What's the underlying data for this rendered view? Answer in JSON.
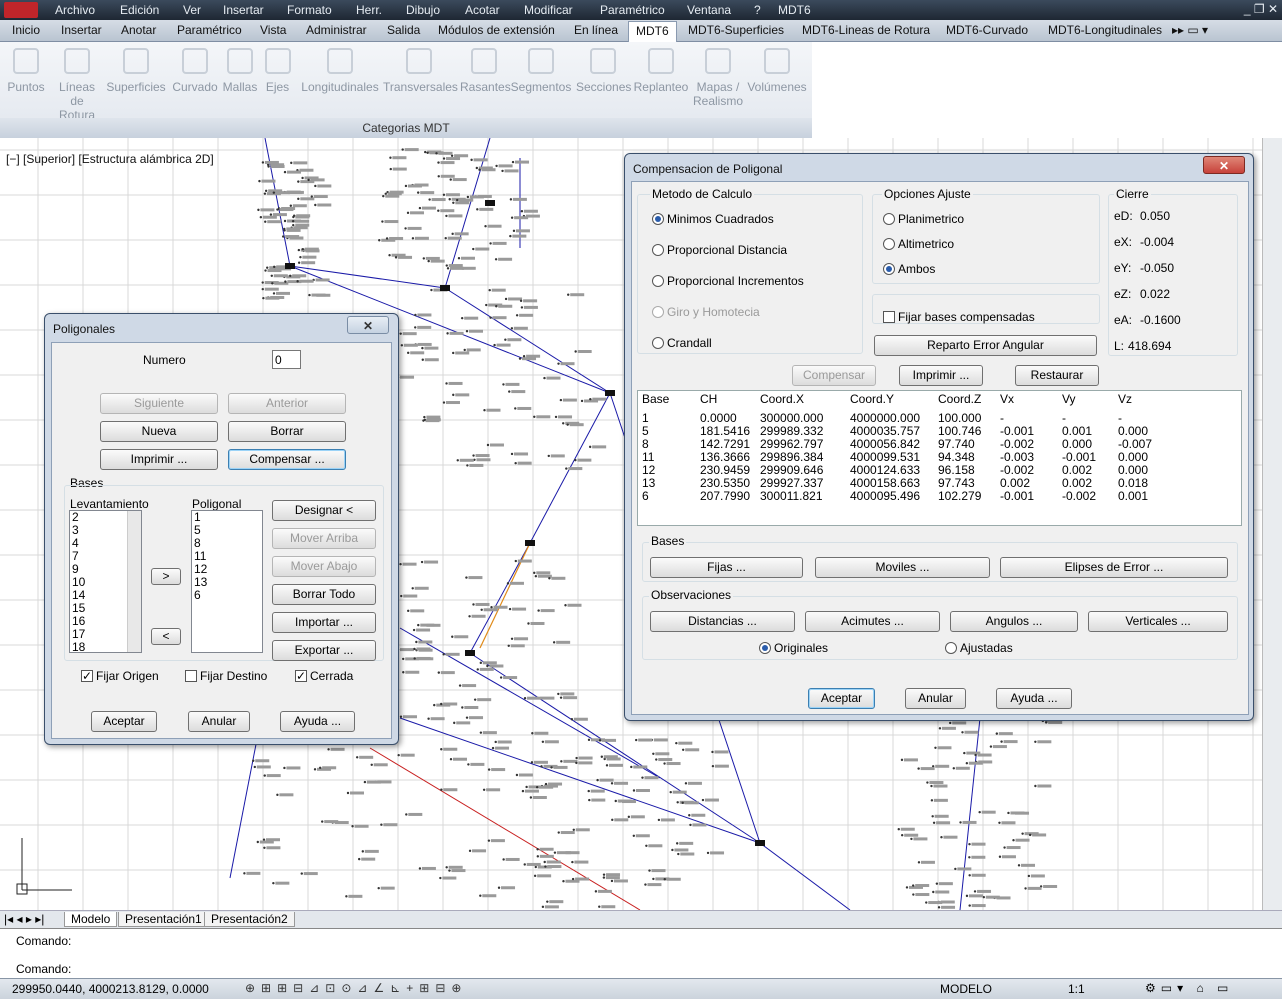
{
  "menubar": {
    "items": [
      "Archivo",
      "Edición",
      "Ver",
      "Insertar",
      "Formato",
      "Herr.",
      "Dibujo",
      "Acotar",
      "Modificar",
      "Paramétrico",
      "Ventana",
      "?",
      "MDT6"
    ]
  },
  "tabs": {
    "items": [
      "Inicio",
      "Insertar",
      "Anotar",
      "Paramétrico",
      "Vista",
      "Administrar",
      "Salida",
      "Módulos de extensión",
      "En línea",
      "MDT6",
      "MDT6-Superficies",
      "MDT6-Lineas de Rotura",
      "MDT6-Curvado",
      "MDT6-Longitudinales"
    ],
    "active": "MDT6"
  },
  "ribbon": {
    "buttons": [
      "Puntos",
      "Líneas de Rotura",
      "Superficies",
      "Curvado",
      "Mallas",
      "Ejes",
      "Longitudinales",
      "Transversales",
      "Rasantes",
      "Segmentos",
      "Secciones",
      "Replanteo",
      "Mapas / Realismo",
      "Volúmenes"
    ],
    "panel_title": "Categorias MDT"
  },
  "viewport": {
    "label": "[−] [Superior] [Estructura alámbrica 2D]"
  },
  "layout_tabs": [
    "Modelo",
    "Presentación1",
    "Presentación2"
  ],
  "command": {
    "line1": "Comando:",
    "line2": "Comando:"
  },
  "status": {
    "coords": "299950.0440, 4000213.8129, 0.0000",
    "mode": "MODELO",
    "scale": "1:1"
  },
  "poligonales": {
    "title": "Poligonales",
    "numero_label": "Numero",
    "numero_value": "0",
    "siguiente": "Siguiente",
    "anterior": "Anterior",
    "nueva": "Nueva",
    "borrar": "Borrar",
    "imprimir": "Imprimir ...",
    "compensar": "Compensar ...",
    "bases_label": "Bases",
    "levantamiento_label": "Levantamiento",
    "poligonal_label": "Poligonal",
    "levantamiento": [
      "2",
      "3",
      "4",
      "7",
      "9",
      "10",
      "14",
      "15",
      "16",
      "17",
      "18"
    ],
    "poligonal": [
      "1",
      "5",
      "8",
      "11",
      "12",
      "13",
      "6"
    ],
    "designar": "Designar <",
    "mover_arriba": "Mover Arriba",
    "mover_abajo": "Mover Abajo",
    "borrar_todo": "Borrar Todo",
    "importar": "Importar ...",
    "exportar": "Exportar ...",
    "fijar_origen": "Fijar Origen",
    "fijar_destino": "Fijar Destino",
    "cerrada": "Cerrada",
    "aceptar": "Aceptar",
    "anular": "Anular",
    "ayuda": "Ayuda ..."
  },
  "compensacion": {
    "title": "Compensacion de Poligonal",
    "metodo_label": "Metodo de Calculo",
    "metodos": [
      "Minimos Cuadrados",
      "Proporcional Distancia",
      "Proporcional Incrementos",
      "Giro y Homotecia",
      "Crandall"
    ],
    "opciones_label": "Opciones Ajuste",
    "opciones": [
      "Planimetrico",
      "Altimetrico",
      "Ambos"
    ],
    "fijar_bases": "Fijar bases compensadas",
    "reparto": "Reparto Error Angular",
    "cierre_label": "Cierre",
    "cierre": [
      {
        "k": "eD:",
        "v": "0.050"
      },
      {
        "k": "eX:",
        "v": "-0.004"
      },
      {
        "k": "eY:",
        "v": "-0.050"
      },
      {
        "k": "eZ:",
        "v": "0.022"
      },
      {
        "k": "eA:",
        "v": "-0.1600"
      },
      {
        "k": "L:",
        "v": "418.694"
      }
    ],
    "compensar": "Compensar",
    "imprimir": "Imprimir ...",
    "restaurar": "Restaurar",
    "columns": [
      "Base",
      "CH",
      "Coord.X",
      "Coord.Y",
      "Coord.Z",
      "Vx",
      "Vy",
      "Vz"
    ],
    "rows": [
      [
        "1",
        "0.0000",
        "300000.000",
        "4000000.000",
        "100.000",
        "-",
        "-",
        "-"
      ],
      [
        "5",
        "181.5416",
        "299989.332",
        "4000035.757",
        "100.746",
        "-0.001",
        "0.001",
        "0.000"
      ],
      [
        "8",
        "142.7291",
        "299962.797",
        "4000056.842",
        "97.740",
        "-0.002",
        "0.000",
        "-0.007"
      ],
      [
        "11",
        "136.3666",
        "299896.384",
        "4000099.531",
        "94.348",
        "-0.003",
        "-0.001",
        "0.000"
      ],
      [
        "12",
        "230.9459",
        "299909.646",
        "4000124.633",
        "96.158",
        "-0.002",
        "0.002",
        "0.000"
      ],
      [
        "13",
        "230.5350",
        "299927.337",
        "4000158.663",
        "97.743",
        "0.002",
        "0.002",
        "0.018"
      ],
      [
        "6",
        "207.7990",
        "300011.821",
        "4000095.496",
        "102.279",
        "-0.001",
        "-0.002",
        "0.001"
      ]
    ],
    "bases_label": "Bases",
    "fijas": "Fijas ...",
    "moviles": "Moviles ...",
    "elipses": "Elipses de Error ...",
    "observaciones_label": "Observaciones",
    "distancias": "Distancias ...",
    "acimutes": "Acimutes ...",
    "angulos": "Angulos ...",
    "verticales": "Verticales ...",
    "originales": "Originales",
    "ajustadas": "Ajustadas",
    "aceptar": "Aceptar",
    "anular": "Anular",
    "ayuda": "Ayuda ..."
  },
  "colors": {
    "title_bar": "#cfd9e6",
    "close": "#c7423a",
    "traverse_line": "#1a1aa8",
    "orange": "#e08a18",
    "red": "#c82020"
  }
}
